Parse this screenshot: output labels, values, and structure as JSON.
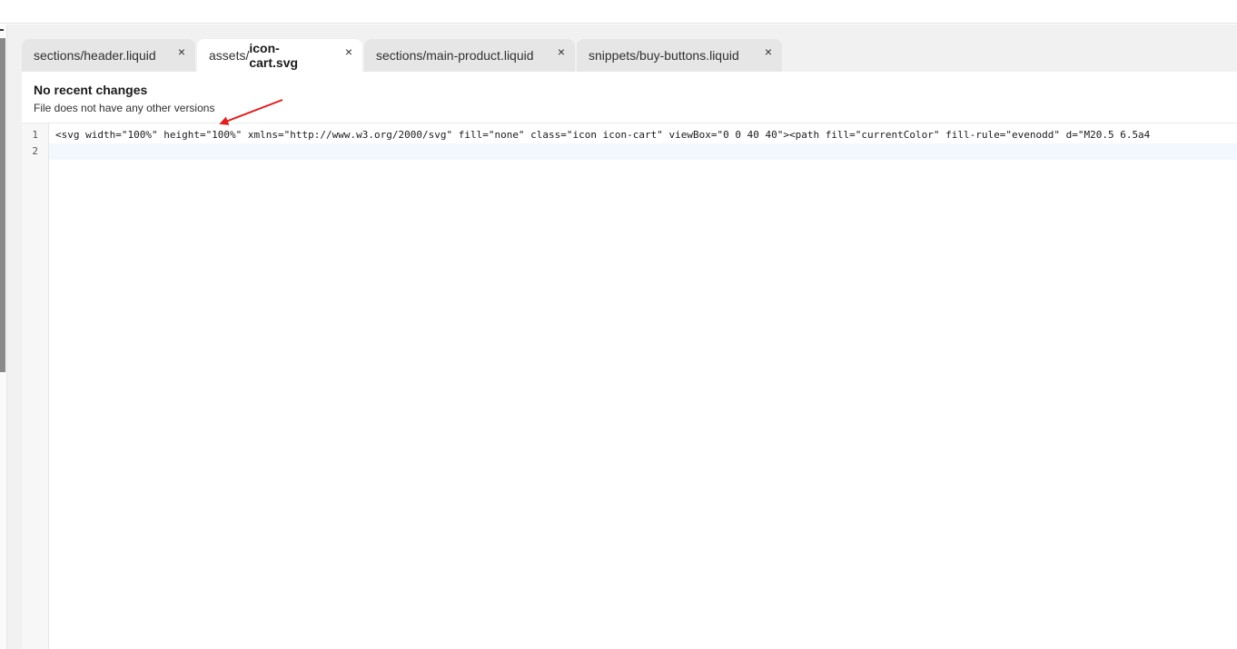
{
  "tabs": [
    {
      "prefix": "sections/header.liquid",
      "name": "",
      "close": "×",
      "active": false
    },
    {
      "prefix": "assets/",
      "name": "icon-cart.svg",
      "close": "×",
      "active": true
    },
    {
      "prefix": "sections/main-product.liquid",
      "name": "",
      "close": "×",
      "active": false
    },
    {
      "prefix": "snippets/buy-buttons.liquid",
      "name": "",
      "close": "×",
      "active": false
    }
  ],
  "info": {
    "title": "No recent changes",
    "subtitle": "File does not have any other versions"
  },
  "editor": {
    "lines": [
      {
        "number": "1",
        "text": "<svg width=\"100%\" height=\"100%\" xmlns=\"http://www.w3.org/2000/svg\" fill=\"none\" class=\"icon icon-cart\" viewBox=\"0 0 40 40\"><path fill=\"currentColor\" fill-rule=\"evenodd\" d=\"M20.5 6.5a4"
      },
      {
        "number": "2",
        "text": ""
      }
    ]
  },
  "annotation": {
    "color": "#e02020"
  }
}
